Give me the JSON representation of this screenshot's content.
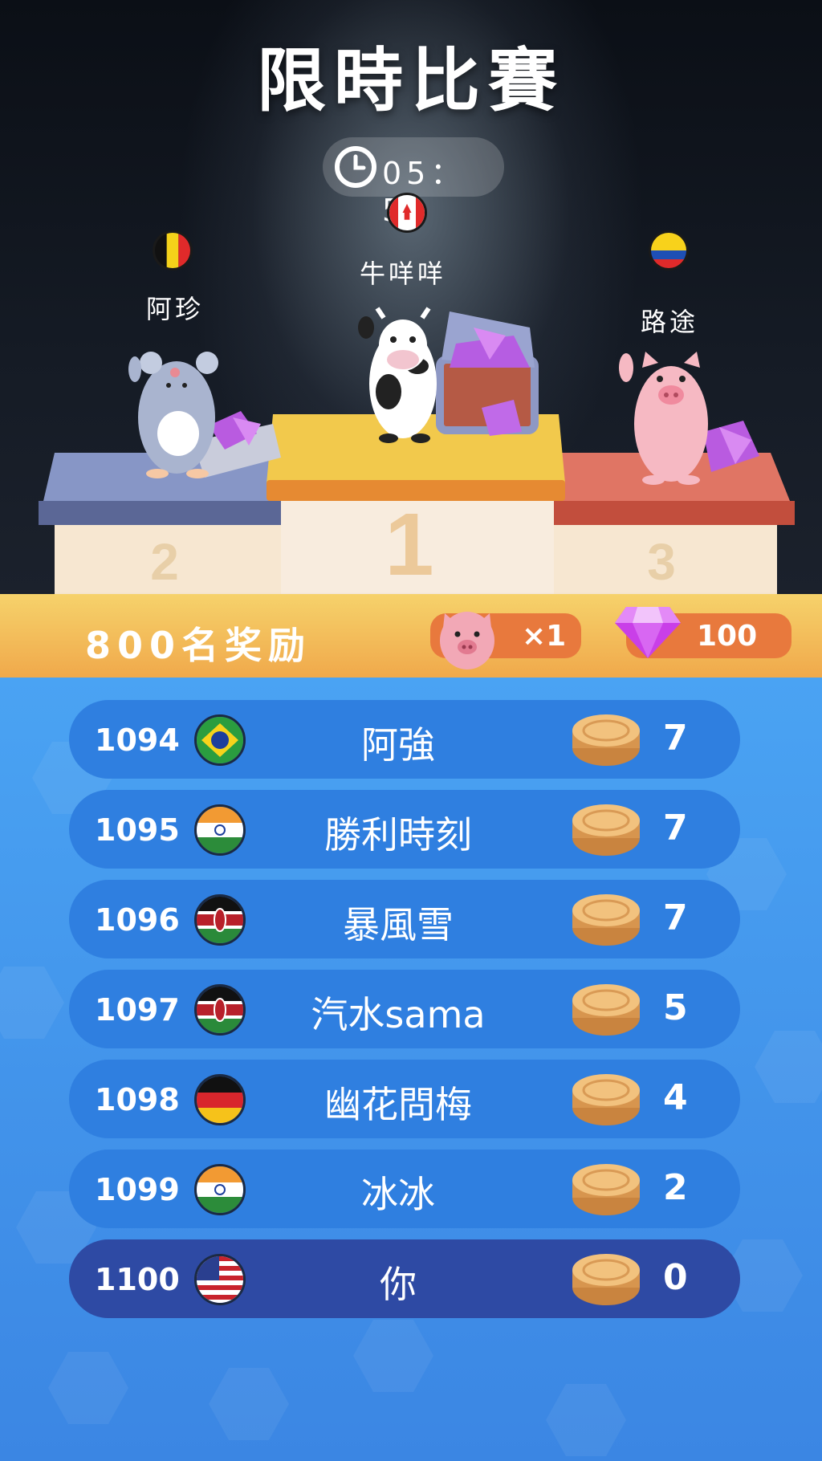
{
  "header": {
    "title": "限時比賽",
    "timer": "05：58"
  },
  "podium": [
    {
      "place": "1",
      "name": "牛咩咩",
      "flag": "canada",
      "avatar": "cow"
    },
    {
      "place": "2",
      "name": "阿珍",
      "flag": "belgium",
      "avatar": "mouse"
    },
    {
      "place": "3",
      "name": "路途",
      "flag": "colombia",
      "avatar": "pig"
    }
  ],
  "reward": {
    "label": "800名奖励",
    "pig_count": "×1",
    "gem_count": "100"
  },
  "leaderboard": [
    {
      "rank": "1094",
      "name": "阿強",
      "flag": "brazil",
      "score": "7"
    },
    {
      "rank": "1095",
      "name": "勝利時刻",
      "flag": "india",
      "score": "7"
    },
    {
      "rank": "1096",
      "name": "暴風雪",
      "flag": "kenya",
      "score": "7"
    },
    {
      "rank": "1097",
      "name": "汽水sama",
      "flag": "kenya",
      "score": "5"
    },
    {
      "rank": "1098",
      "name": "幽花問梅",
      "flag": "germany",
      "score": "4"
    },
    {
      "rank": "1099",
      "name": "冰冰",
      "flag": "india",
      "score": "2"
    },
    {
      "rank": "1100",
      "name": "你",
      "flag": "usa",
      "score": "0",
      "is_you": true
    }
  ],
  "colors": {
    "accent": "#f0a94b",
    "row": "#2f7fe0",
    "row_you": "#2e4aa4",
    "list_bg": "#4aa3f3"
  }
}
